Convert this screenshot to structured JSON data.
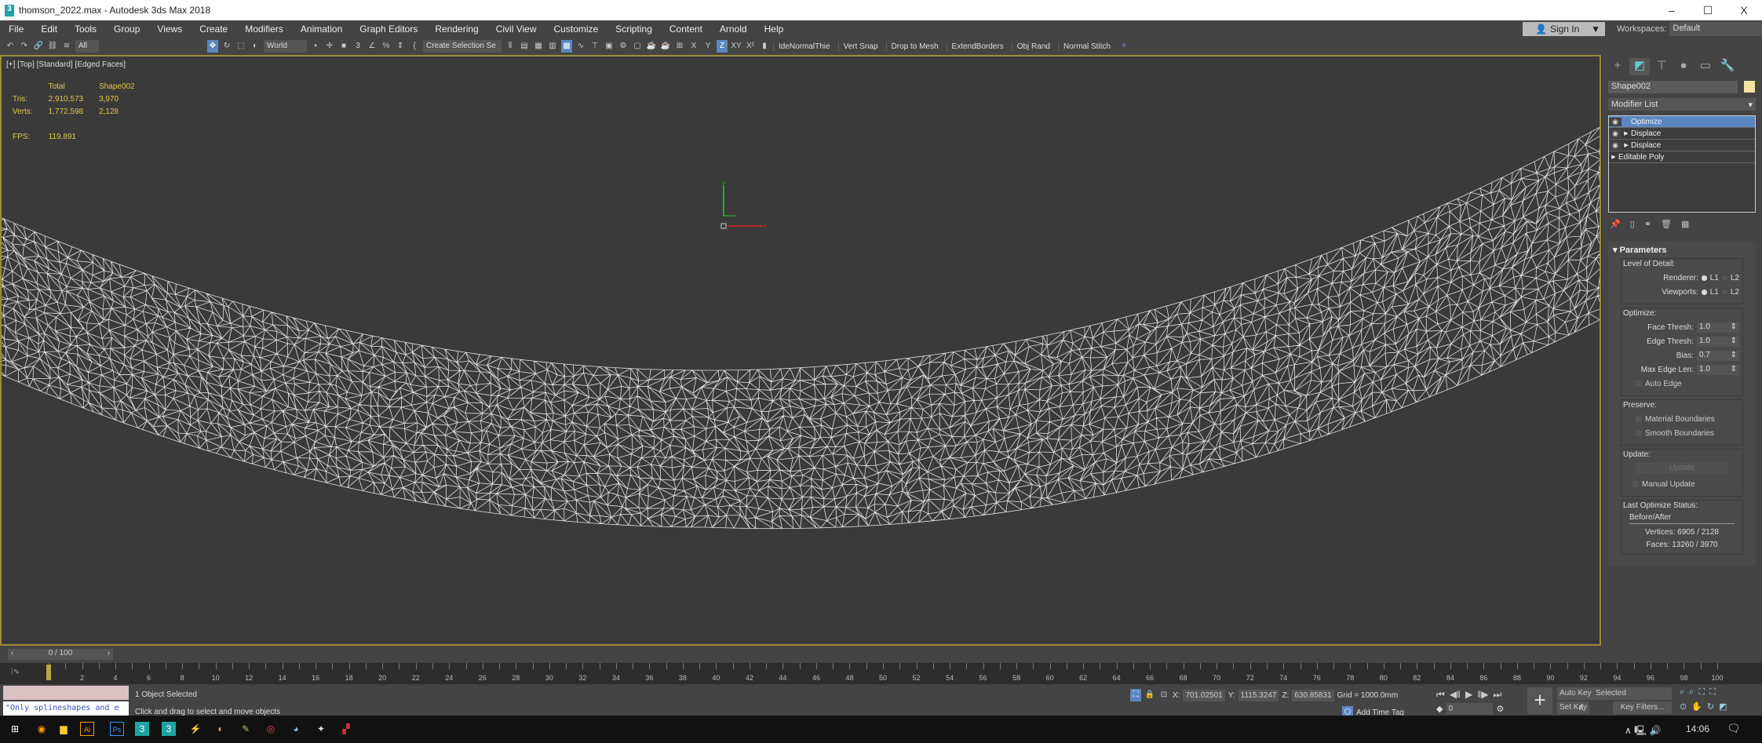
{
  "title": "thomson_2022.max - Autodesk 3ds Max 2018",
  "window_controls": [
    "–",
    "☐",
    "X"
  ],
  "menu": [
    "File",
    "Edit",
    "Tools",
    "Group",
    "Views",
    "Create",
    "Modifiers",
    "Animation",
    "Graph Editors",
    "Rendering",
    "Civil View",
    "Customize",
    "Scripting",
    "Content",
    "Arnold",
    "Help"
  ],
  "signin": "Sign In",
  "workspaces": {
    "label": "Workspaces:",
    "value": "Default"
  },
  "toolbar": {
    "filter": "All",
    "coord_system": "World",
    "selection_set": "Create Selection Se",
    "axes": [
      "X",
      "Y",
      "Z",
      "XY"
    ],
    "scripts": [
      "IdeNormalThie",
      "Vert Snap",
      "Drop to Mesh",
      "ExtendBorders",
      "Obj Rand",
      "Normal Stitch"
    ]
  },
  "viewport": {
    "label": "[+] [Top] [Standard] [Edged Faces]",
    "stats": {
      "headers": [
        "Total",
        "Shape002"
      ],
      "tris_label": "Tris:",
      "tris": [
        "2,910,573",
        "3,970"
      ],
      "verts_label": "Verts:",
      "verts": [
        "1,772,598",
        "2,128"
      ],
      "fps_label": "FPS:",
      "fps": "119.891"
    },
    "mesh_color": "#ffffff",
    "selection_border": "#9e8a3c"
  },
  "command_panel": {
    "object_name": "Shape002",
    "object_color": "#f1e4a0",
    "modifier_list": "Modifier List",
    "stack": [
      {
        "label": "Optimize",
        "selected": true
      },
      {
        "label": "Displace"
      },
      {
        "label": "Displace"
      },
      {
        "label": "Editable Poly"
      }
    ],
    "parameters": {
      "title": "Parameters",
      "lod": {
        "title": "Level of Detail:",
        "renderer": "Renderer:",
        "viewports": "Viewports:",
        "l1": "L1",
        "l2": "L2"
      },
      "optimize": {
        "title": "Optimize:",
        "face_thresh": "Face Thresh:",
        "face_thresh_val": "1.0",
        "edge_thresh": "Edge Thresh:",
        "edge_thresh_val": "1.0",
        "bias": "Bias:",
        "bias_val": "0.7",
        "max_edge": "Max Edge Len:",
        "max_edge_val": "1.0",
        "auto_edge": "Auto Edge"
      },
      "preserve": {
        "title": "Preserve:",
        "material": "Material Boundaries",
        "smooth": "Smooth Boundaries"
      },
      "update": {
        "title": "Update:",
        "button": "Update",
        "manual": "Manual Update"
      },
      "status": {
        "title": "Last Optimize Status:",
        "header": "Before/After",
        "vertices": "Vertices: 6905 / 2128",
        "faces": "Faces: 13260 / 3970"
      }
    }
  },
  "time_slider": {
    "value": "0 / 100",
    "current": 0,
    "max": 100
  },
  "status": {
    "selected": "1 Object Selected",
    "prompt": "Click and drag to select and move objects",
    "maxscript": "\"Only splineshapes and e"
  },
  "coords": {
    "x_label": "X:",
    "x": "701.02501",
    "y_label": "Y:",
    "y": "1115.3247",
    "z_label": "Z:",
    "z": "630.85831",
    "grid": "Grid = 1000.0mm",
    "add_time_tag": "Add Time Tag"
  },
  "anim": {
    "frame": "0",
    "auto_key": "Auto Key",
    "set_key": "Set Key",
    "selected": "Selected",
    "key_filters": "Key Filters..."
  },
  "clock": "14:06"
}
